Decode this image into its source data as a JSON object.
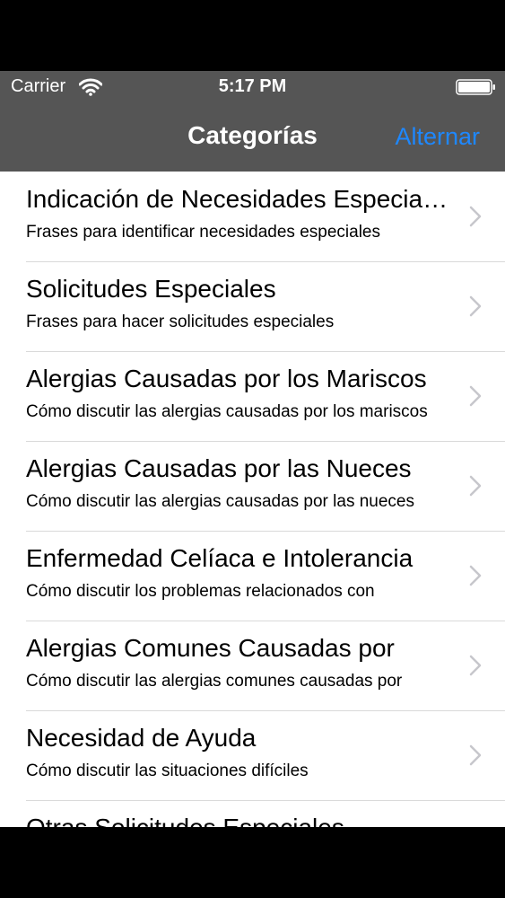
{
  "status_bar": {
    "carrier": "Carrier",
    "time": "5:17 PM",
    "wifi_icon": "wifi-icon",
    "battery_icon": "battery-full-icon"
  },
  "nav": {
    "title": "Categorías",
    "right_button": "Alternar"
  },
  "colors": {
    "bar_background": "#555555",
    "accent": "#1e88ff",
    "separator": "#d9d9d9"
  },
  "rows": [
    {
      "title": "Indicación de Necesidades Especiales",
      "subtitle": "Frases para identificar necesidades especiales"
    },
    {
      "title": "Solicitudes Especiales",
      "subtitle": "Frases para hacer solicitudes especiales"
    },
    {
      "title": "Alergias Causadas por los Mariscos",
      "subtitle": "Cómo discutir las alergias causadas por los mariscos"
    },
    {
      "title": "Alergias Causadas por las Nueces",
      "subtitle": "Cómo discutir las alergias causadas por las nueces"
    },
    {
      "title": "Enfermedad Celíaca e Intolerancia",
      "subtitle": "Cómo discutir los problemas relacionados con"
    },
    {
      "title": "Alergias Comunes Causadas por",
      "subtitle": "Cómo discutir las alergias comunes causadas por"
    },
    {
      "title": "Necesidad de Ayuda",
      "subtitle": "Cómo discutir las situaciones difíciles"
    },
    {
      "title": "Otras Solicitudes Especiales",
      "subtitle": ""
    }
  ]
}
